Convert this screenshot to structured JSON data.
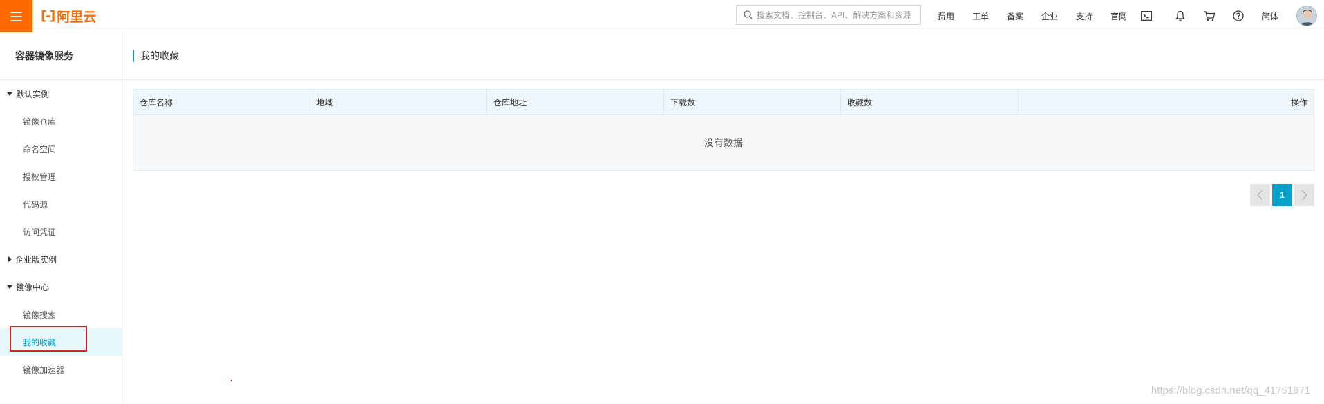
{
  "topbar": {
    "brand": "阿里云",
    "logo_mark": "[-]",
    "search_placeholder": "搜索文档、控制台、API、解决方案和资源",
    "nav": [
      "费用",
      "工单",
      "备案",
      "企业",
      "支持",
      "官网"
    ],
    "icons": [
      "terminal-icon",
      "bell-icon",
      "cart-icon",
      "help-icon"
    ],
    "language": "简体"
  },
  "sidebar": {
    "title": "容器镜像服务",
    "group_default": "默认实例",
    "default_items": [
      "镜像仓库",
      "命名空间",
      "授权管理",
      "代码源",
      "访问凭证"
    ],
    "group_enterprise": "企业版实例",
    "group_center": "镜像中心",
    "center_items": [
      "镜像搜索",
      "我的收藏",
      "镜像加速器"
    ],
    "active_item": "我的收藏"
  },
  "main": {
    "title": "我的收藏",
    "table": {
      "columns": [
        "仓库名称",
        "地域",
        "仓库地址",
        "下载数",
        "收藏数",
        "操作"
      ],
      "empty_text": "没有数据"
    },
    "pagination": {
      "current_page": "1"
    }
  },
  "watermark": "https://blog.csdn.net/qq_41751871",
  "colors": {
    "brand_orange": "#ff6a00",
    "accent_blue": "#00a2ca",
    "highlight_red": "#e02020"
  }
}
